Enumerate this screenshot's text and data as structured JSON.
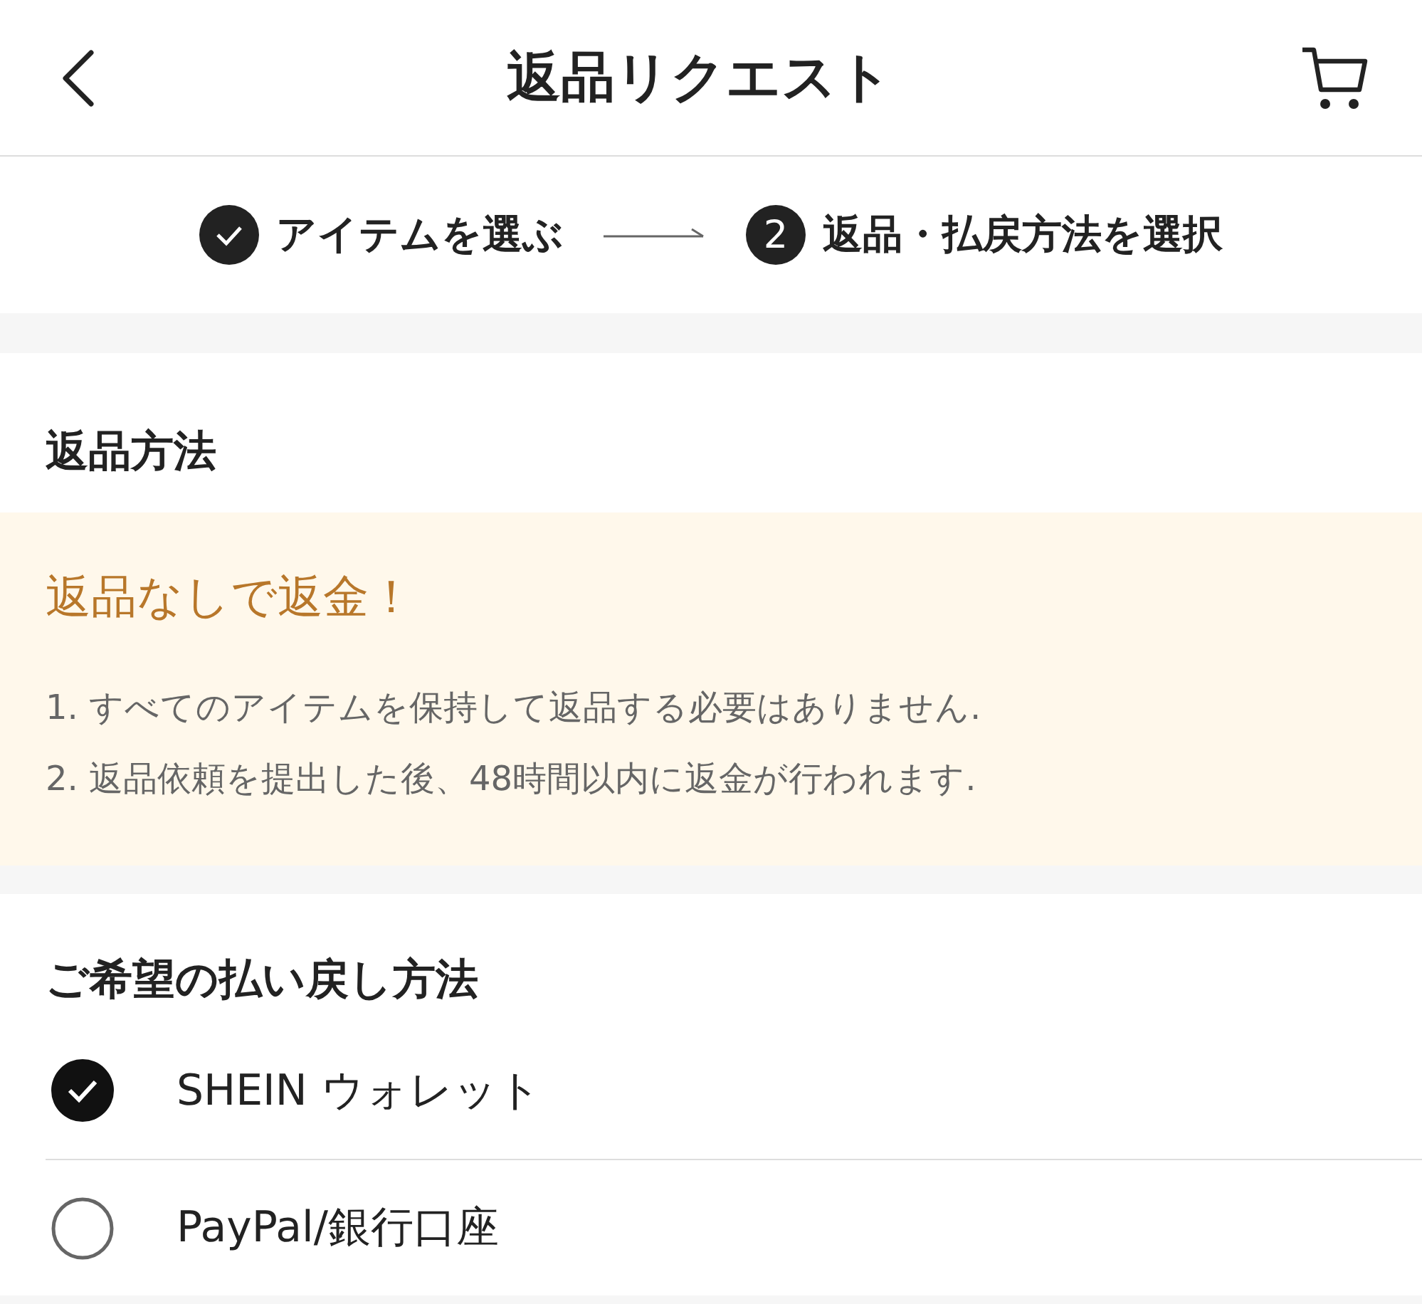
{
  "header": {
    "title": "返品リクエスト"
  },
  "steps": [
    {
      "kind": "done",
      "label": "アイテムを選ぶ"
    },
    {
      "kind": "current",
      "number": "2",
      "label": "返品・払戻方法を選択"
    }
  ],
  "return_method": {
    "title": "返品方法",
    "notice": {
      "title": "返品なしで返金！",
      "lines": [
        "1. すべてのアイテムを保持して返品する必要はありません.",
        "2. 返品依頼を提出した後、48時間以内に返金が行われます."
      ]
    }
  },
  "refund": {
    "title": "ご希望の払い戻し方法",
    "options": [
      {
        "label": "SHEIN ウォレット",
        "selected": true
      },
      {
        "label": "PayPal/銀行口座",
        "selected": false
      }
    ]
  }
}
